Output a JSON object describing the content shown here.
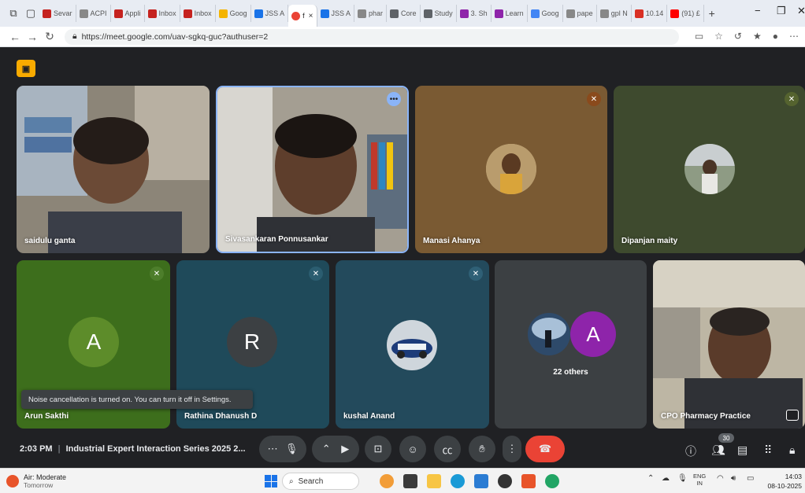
{
  "browser": {
    "tabs": [
      {
        "label": "Sevar",
        "color": "#c5221f"
      },
      {
        "label": "ACPI",
        "color": "#888888"
      },
      {
        "label": "Appli",
        "color": "#c5221f"
      },
      {
        "label": "Inbox",
        "color": "#c5221f"
      },
      {
        "label": "Inbox",
        "color": "#c5221f"
      },
      {
        "label": "Goog",
        "color": "#f4b400"
      },
      {
        "label": "JSS A",
        "color": "#1a73e8"
      }
    ],
    "active_tab": {
      "label": "f",
      "close": "×"
    },
    "tabs_after": [
      {
        "label": "JSS A",
        "color": "#1a73e8"
      },
      {
        "label": "phar",
        "color": "#888888"
      },
      {
        "label": "Core",
        "color": "#5f6368"
      },
      {
        "label": "Study",
        "color": "#5f6368"
      },
      {
        "label": "3. Sh",
        "color": "#8e24aa"
      },
      {
        "label": "Learn",
        "color": "#8e24aa"
      },
      {
        "label": "Goog",
        "color": "#4285f4"
      },
      {
        "label": "pape",
        "color": "#888888"
      },
      {
        "label": "gpl N",
        "color": "#888888"
      },
      {
        "label": "10.14",
        "color": "#d93025"
      },
      {
        "label": "(91) £",
        "color": "#ff0000"
      }
    ],
    "new_tab": "+",
    "url": "https://meet.google.com/uav-sgkq-guc?authuser=2"
  },
  "meet": {
    "participants": [
      {
        "name": "saidulu ganta",
        "kind": "video",
        "bg": "#8c8578"
      },
      {
        "name": "Sivasankaran Ponnusankar",
        "kind": "video",
        "bg": "#6e6a62",
        "speaking": true
      },
      {
        "name": "Manasi Ahanya",
        "kind": "photo",
        "bg": "#7a5a33",
        "muted": true
      },
      {
        "name": "Dipanjan maity",
        "kind": "photo",
        "bg": "#3e4a2e",
        "muted": true
      },
      {
        "name": "Arun Sakthi",
        "kind": "letter",
        "letter": "A",
        "bg": "#3d6e1c",
        "avatar": "#5d8c2a",
        "muted": true
      },
      {
        "name": "Rathina Dhanush D",
        "kind": "letter",
        "letter": "R",
        "bg": "#1f4a5a",
        "avatar": "#3c4043",
        "muted": true
      },
      {
        "name": "kushal Anand",
        "kind": "photo",
        "bg": "#234a5c",
        "muted": true
      },
      {
        "name": "",
        "kind": "others",
        "letter": "A",
        "bg": "#3c4043",
        "avatar": "#8e24aa",
        "others_label": "22 others"
      },
      {
        "name": "CPO Pharmacy Practice",
        "kind": "video",
        "bg": "#6f6a5f"
      }
    ],
    "toast": "Noise cancellation is turned on. You can turn it off in Settings.",
    "time": "2:03 PM",
    "separator": "|",
    "meeting_title": "Industrial Expert Interaction Series 2025 2...",
    "participant_count": "30"
  },
  "taskbar": {
    "weather_title": "Air: Moderate",
    "weather_sub": "Tomorrow",
    "search": "Search",
    "lang": "ENG",
    "region": "IN",
    "time": "14:03",
    "date": "08-10-2025"
  },
  "colors": {
    "accent_yellow": "#f9ab00",
    "end_call": "#ea4335",
    "speaking_border": "#8ab4f8"
  }
}
